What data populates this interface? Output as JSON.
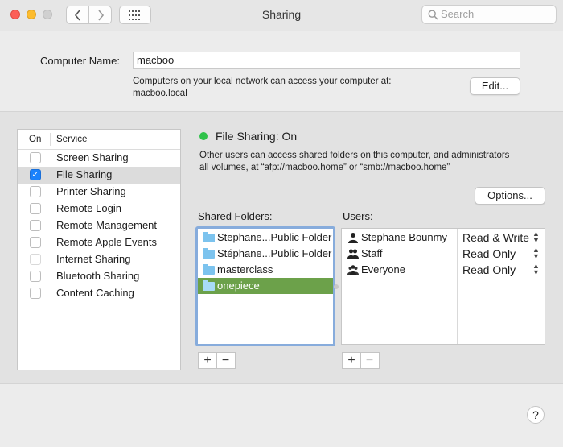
{
  "window": {
    "title": "Sharing"
  },
  "toolbar": {
    "back_icon": "chevron-left-icon",
    "forward_icon": "chevron-right-icon",
    "grid_icon": "grid-icon",
    "search_placeholder": "Search"
  },
  "computer_name": {
    "label": "Computer Name:",
    "value": "macboo",
    "note_line1": "Computers on your local network can access your computer at:",
    "note_line2": "macboo.local",
    "edit_label": "Edit..."
  },
  "services": {
    "header_on": "On",
    "header_service": "Service",
    "items": [
      {
        "label": "Screen Sharing",
        "checked": false,
        "selected": false
      },
      {
        "label": "File Sharing",
        "checked": true,
        "selected": true
      },
      {
        "label": "Printer Sharing",
        "checked": false,
        "selected": false
      },
      {
        "label": "Remote Login",
        "checked": false,
        "selected": false
      },
      {
        "label": "Remote Management",
        "checked": false,
        "selected": false
      },
      {
        "label": "Remote Apple Events",
        "checked": false,
        "selected": false
      },
      {
        "label": "Internet Sharing",
        "checked": false,
        "selected": false,
        "dimmed": true
      },
      {
        "label": "Bluetooth Sharing",
        "checked": false,
        "selected": false
      },
      {
        "label": "Content Caching",
        "checked": false,
        "selected": false
      }
    ]
  },
  "status": {
    "text": "File Sharing: On",
    "color": "#2fc24a",
    "desc_line1": "Other users can access shared folders on this computer, and administrators",
    "desc_line2": "all volumes, at “afp://macboo.home” or “smb://macboo.home”",
    "options_label": "Options..."
  },
  "shared_folders": {
    "label": "Shared Folders:",
    "items": [
      {
        "label": "Stephane...Public Folder",
        "selected": false
      },
      {
        "label": "Stéphane...Public Folder",
        "selected": false
      },
      {
        "label": "masterclass",
        "selected": false
      },
      {
        "label": "onepiece",
        "selected": true
      }
    ],
    "add": "+",
    "remove": "−"
  },
  "users": {
    "label": "Users:",
    "items": [
      {
        "name": "Stephane Bounmy",
        "permission": "Read & Write",
        "icon": "user-icon"
      },
      {
        "name": "Staff",
        "permission": "Read Only",
        "icon": "group-icon"
      },
      {
        "name": "Everyone",
        "permission": "Read Only",
        "icon": "everyone-icon"
      }
    ],
    "add": "+",
    "remove": "−"
  },
  "help": {
    "label": "?"
  },
  "colors": {
    "selection_green": "#6ca14a",
    "checkbox_blue": "#1a82fb",
    "focus_ring": "#87acdc"
  }
}
